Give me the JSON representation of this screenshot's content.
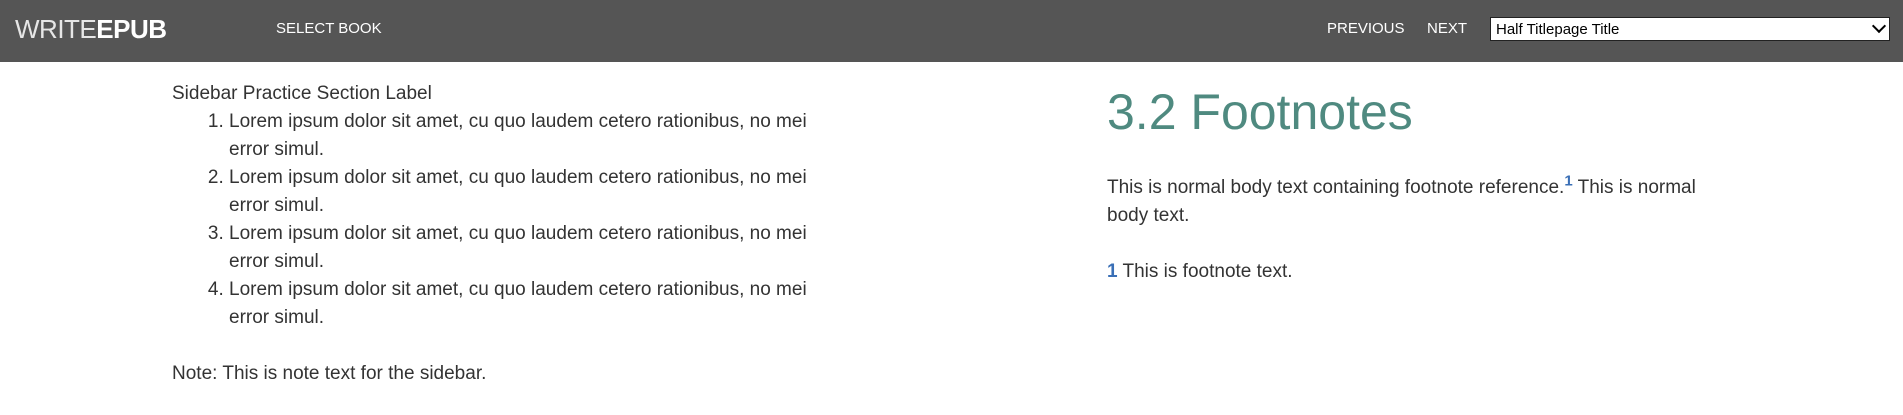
{
  "header": {
    "logo_thin": "WRITE",
    "logo_bold": "EPUB",
    "select_book": "SELECT BOOK",
    "previous": "PREVIOUS",
    "next": "NEXT",
    "chapter_select_value": "Half Titlepage Title",
    "background_color": "#555555"
  },
  "sidebar": {
    "section_label": "Sidebar Practice Section Label",
    "items": [
      "Lorem ipsum dolor sit amet, cu quo laudem cetero rationibus, no mei error simul.",
      "Lorem ipsum dolor sit amet, cu quo laudem cetero rationibus, no mei error simul.",
      "Lorem ipsum dolor sit amet, cu quo laudem cetero rationibus, no mei error simul.",
      "Lorem ipsum dolor sit amet, cu quo laudem cetero rationibus, no mei error simul."
    ],
    "note": "Note: This is note text for the sidebar."
  },
  "main": {
    "heading": "3.2 Footnotes",
    "heading_color": "#4f8a80",
    "body_before": "This is normal body text containing footnote reference.",
    "footnote_ref": "1",
    "body_after": " This is normal body text.",
    "footnote_number": "1",
    "footnote_text": " This is footnote text.",
    "link_color": "#3a6fb6"
  }
}
